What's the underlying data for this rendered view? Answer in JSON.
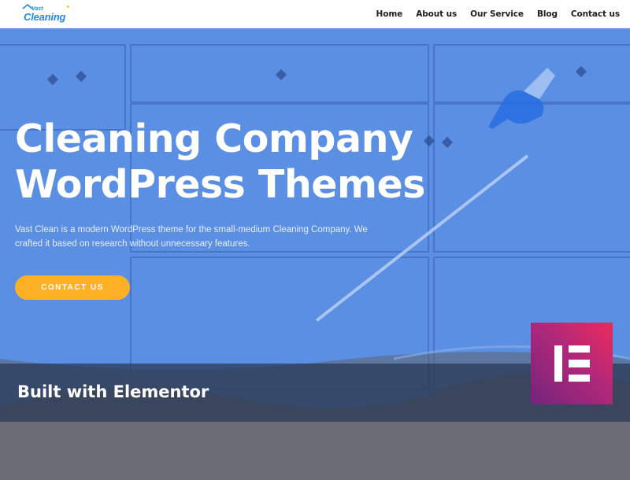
{
  "logo": {
    "top_word": "Vast",
    "bottom_word": "Cleaning",
    "brand_color": "#1e8be6",
    "accent_color": "#f6b023"
  },
  "nav": {
    "items": [
      {
        "label": "Home"
      },
      {
        "label": "About us"
      },
      {
        "label": "Our Service"
      },
      {
        "label": "Blog"
      },
      {
        "label": "Contact us"
      }
    ]
  },
  "hero": {
    "title_line1": "Cleaning Company",
    "title_line2": "WordPress Themes",
    "description": "Vast Clean is a modern WordPress theme for the small-medium Cleaning Company. We crafted it based on research without unnecessary features.",
    "cta_label": "CONTACT US",
    "overlay_color": "#5b8fe3",
    "cta_color": "#fdb023"
  },
  "banner": {
    "text": "Built with Elementor",
    "badge_icon": "elementor-logo-icon"
  }
}
